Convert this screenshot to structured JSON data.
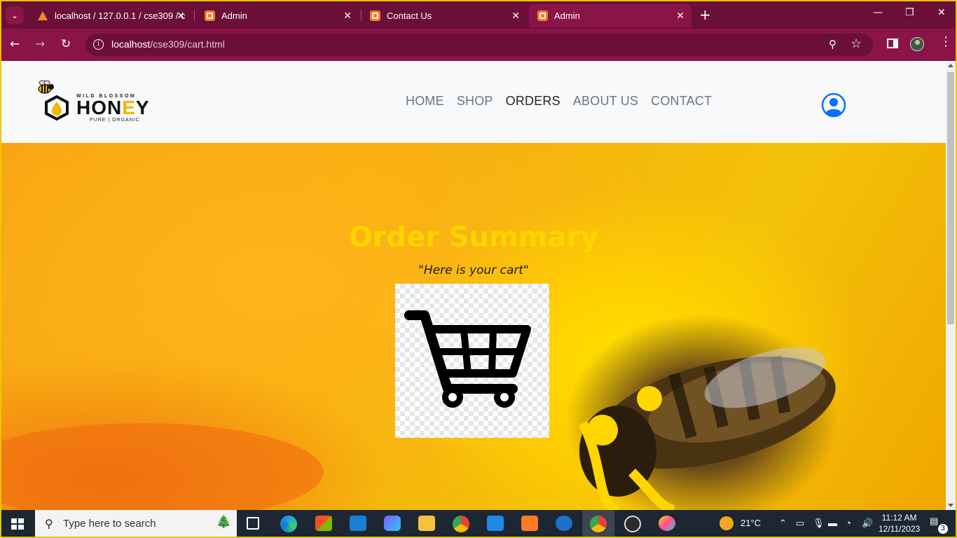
{
  "browser": {
    "tabs": [
      {
        "title": "localhost / 127.0.0.1 / cse309 / c",
        "icon": "phpmyadmin-icon",
        "active": false
      },
      {
        "title": "Admin",
        "icon": "xampp-icon",
        "active": false
      },
      {
        "title": "Contact Us",
        "icon": "xampp-icon",
        "active": false
      },
      {
        "title": "Admin",
        "icon": "xampp-icon",
        "active": true
      }
    ],
    "url_host": "localhost",
    "url_path": "/cse309/cart.html"
  },
  "site": {
    "logo": {
      "top": "WILD BLOSSOM",
      "main_a": "HON",
      "main_e": "E",
      "main_b": "Y",
      "sub": "PURE | ORGANIC"
    },
    "nav": [
      {
        "label": "HOME",
        "active": false
      },
      {
        "label": "SHOP",
        "active": false
      },
      {
        "label": "ORDERS",
        "active": true
      },
      {
        "label": "ABOUT US",
        "active": false
      },
      {
        "label": "CONTACT",
        "active": false
      }
    ],
    "hero": {
      "title": "Order Summary",
      "subtitle": "\"Here is your cart\""
    }
  },
  "taskbar": {
    "search_placeholder": "Type here to search",
    "weather": "21°C",
    "time": "11:12 AM",
    "date": "12/11/2023",
    "notifications": "3"
  },
  "colors": {
    "browser_frame": "#8a1447",
    "tab_strip": "#6b0f38",
    "hero_title": "#ffd400",
    "user_icon": "#0d6efd"
  }
}
